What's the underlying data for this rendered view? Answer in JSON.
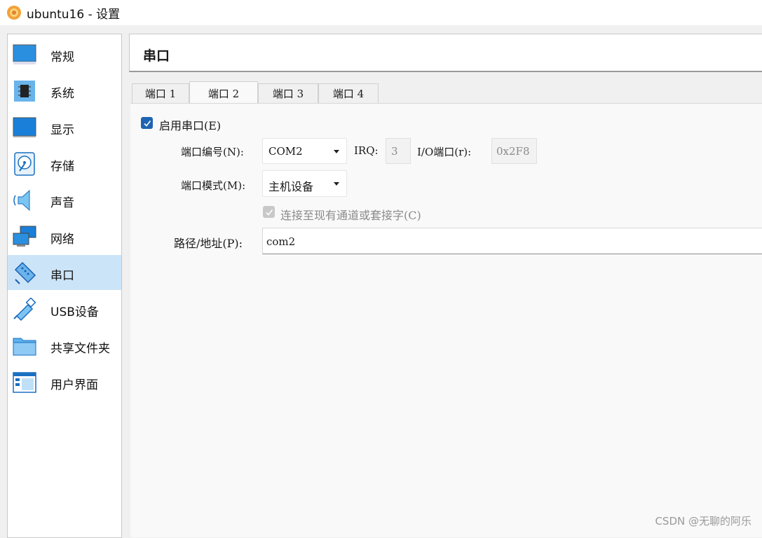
{
  "window": {
    "title": "ubuntu16 - 设置"
  },
  "sidebar": {
    "items": [
      {
        "label": "常规",
        "icon": "monitor-icon"
      },
      {
        "label": "系统",
        "icon": "chip-icon"
      },
      {
        "label": "显示",
        "icon": "display-icon"
      },
      {
        "label": "存储",
        "icon": "disk-icon"
      },
      {
        "label": "声音",
        "icon": "speaker-icon"
      },
      {
        "label": "网络",
        "icon": "network-icon"
      },
      {
        "label": "串口",
        "icon": "serial-port-icon",
        "active": true
      },
      {
        "label": "USB设备",
        "icon": "usb-icon"
      },
      {
        "label": "共享文件夹",
        "icon": "folder-icon"
      },
      {
        "label": "用户界面",
        "icon": "user-interface-icon"
      }
    ]
  },
  "header": {
    "title": "串口"
  },
  "tabs": [
    {
      "label": "端口 1"
    },
    {
      "label": "端口 2",
      "active": true
    },
    {
      "label": "端口 3"
    },
    {
      "label": "端口 4"
    }
  ],
  "form": {
    "enable_label": "启用串口(E)",
    "port_number_label": "端口编号(N):",
    "port_number_value": "COM2",
    "irq_label": "IRQ:",
    "irq_value": "3",
    "io_label": "I/O端口(r):",
    "io_value": "0x2F8",
    "mode_label": "端口模式(M):",
    "mode_value": "主机设备",
    "connect_label": "连接至现有通道或套接字(C)",
    "path_label": "路径/地址(P):",
    "path_value": "com2"
  },
  "watermark": "CSDN @无聊的阿乐",
  "colors": {
    "accent": "#1f64b3",
    "selection": "#cce4f7"
  }
}
